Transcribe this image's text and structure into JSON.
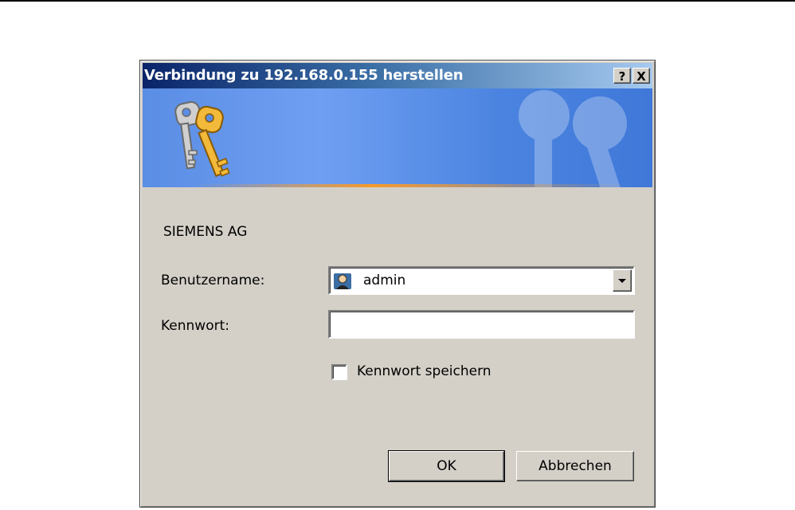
{
  "dialog": {
    "title": "Verbindung zu 192.168.0.155 herstellen",
    "help_icon": "?",
    "close_icon": "X",
    "realm": "SIEMENS AG",
    "username_label": "Benutzername:",
    "username_value": "admin",
    "password_label": "Kennwort:",
    "password_value": "",
    "remember_label": "Kennwort speichern",
    "remember_checked": false,
    "ok_label": "OK",
    "cancel_label": "Abbrechen"
  },
  "icons": {
    "banner": "keys-icon",
    "user": "user-icon",
    "dropdown": "chevron-down-icon"
  },
  "colors": {
    "titlebar_start": "#0a246a",
    "titlebar_end": "#a6caf0",
    "banner": "#5a8de4",
    "dialog_bg": "#d4d0c8",
    "accent_line": "#f59a2a"
  }
}
